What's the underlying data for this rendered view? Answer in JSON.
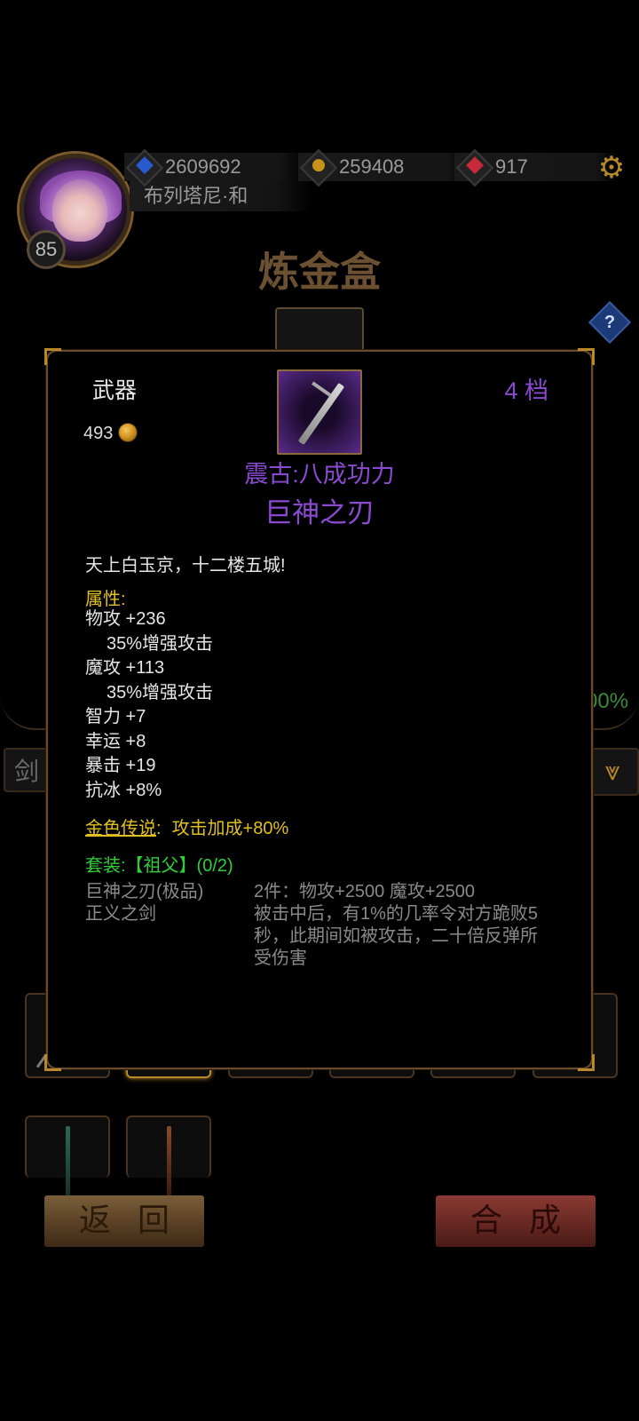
{
  "player": {
    "name": "布列塔尼·和",
    "level": "85"
  },
  "resources": {
    "diamonds": "2609692",
    "gold": "259408",
    "rubies": "917"
  },
  "page_title": "炼金盒",
  "help_label": "?",
  "background": {
    "filter_label": "剑",
    "percent_text": "00%",
    "sort_icon": "⩔"
  },
  "buttons": {
    "back": "返回",
    "merge": "合成"
  },
  "item": {
    "type": "武器",
    "tier": "4  档",
    "price": "493",
    "subname": "震古:八成功力",
    "name": "巨神之刃",
    "description": "天上白玉京，十二楼五城!",
    "attributes_header": "属性:",
    "attributes": [
      {
        "text": "物攻 +236",
        "sub": false
      },
      {
        "text": "35%增强攻击",
        "sub": true
      },
      {
        "text": "魔攻 +113",
        "sub": false
      },
      {
        "text": "35%增强攻击",
        "sub": true
      },
      {
        "text": "智力 +7",
        "sub": false
      },
      {
        "text": "幸运 +8",
        "sub": false
      },
      {
        "text": "暴击 +19",
        "sub": false
      },
      {
        "text": "抗冰 +8%",
        "sub": false
      }
    ],
    "legend_label": "金色传说",
    "legend_colon": ":",
    "legend_effect": "攻击加成+80%",
    "set_title": "套装:【祖父】(0/2)",
    "set_items": [
      "巨神之刃(极品)",
      "正义之剑"
    ],
    "set_bonus_lines": [
      "2件：物攻+2500 魔攻+2500",
      "被击中后，有1%的几率令对方跪败5",
      "秒，此期间如被攻击，二十倍反弹所",
      "受伤害"
    ]
  },
  "colors": {
    "rarity_purple": "#8a4ad0",
    "gold_text": "#e0c020",
    "set_green": "#2ecf3a",
    "frame_brown": "#6a4a2a"
  }
}
